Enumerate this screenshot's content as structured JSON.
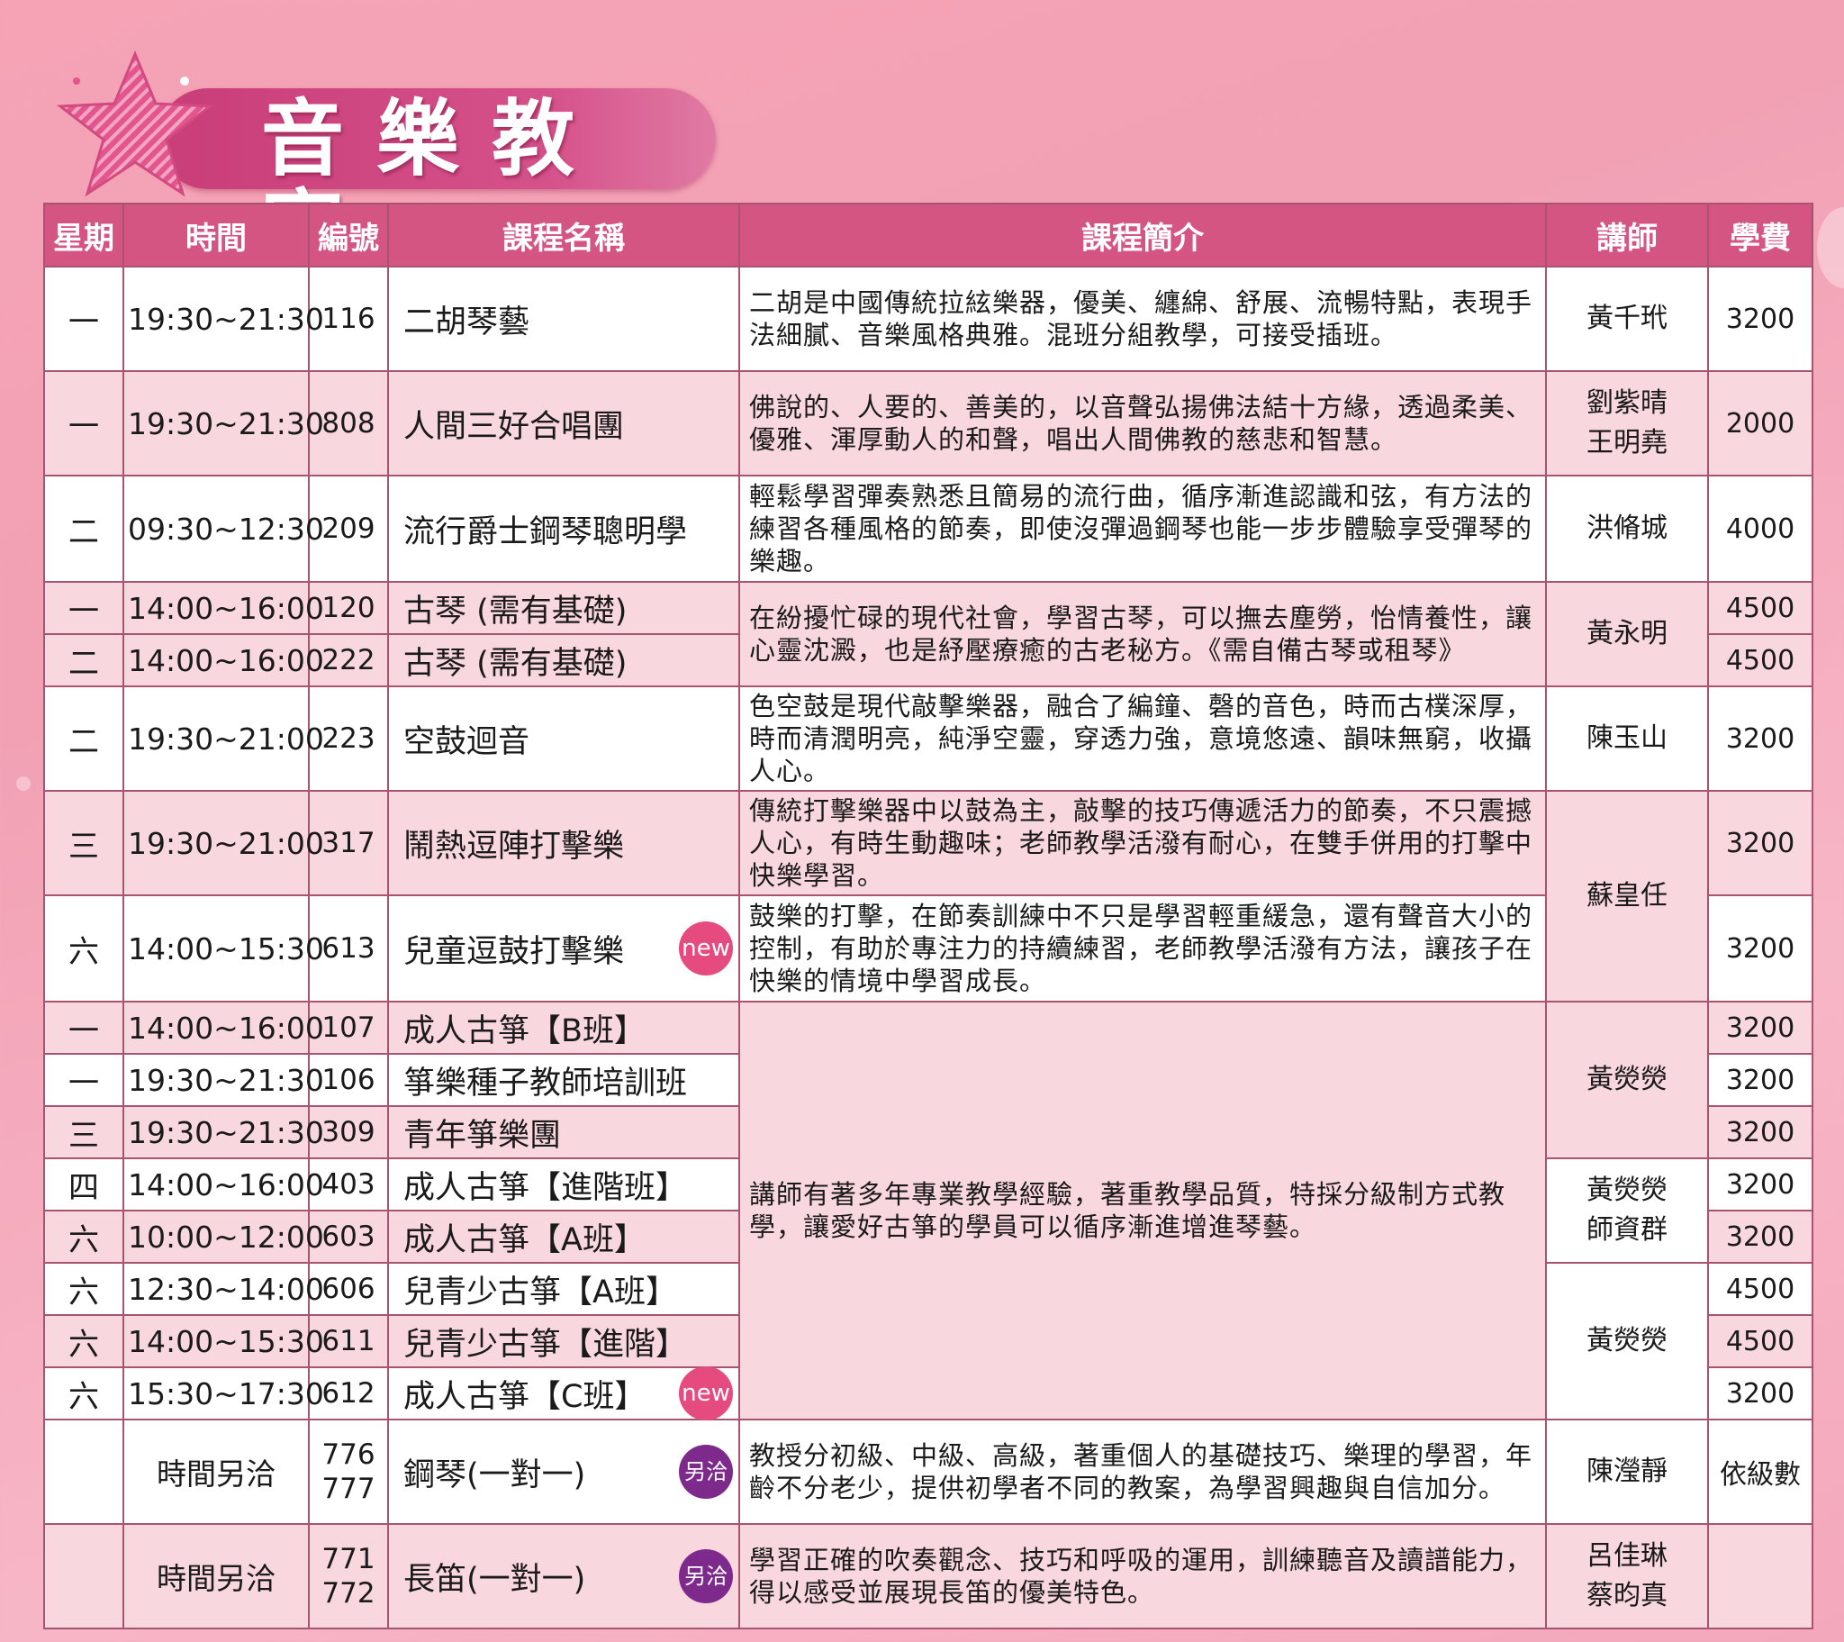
{
  "page": {
    "title": "音樂教室",
    "colors": {
      "header_bg": "#d45582",
      "row_pink": "#f9d7de",
      "row_white": "#ffffff",
      "badge_new": "#e54b7f",
      "badge_other": "#7e2a8c"
    }
  },
  "table": {
    "headers": [
      "星期",
      "時間",
      "編號",
      "課程名稱",
      "課程簡介",
      "講師",
      "學費"
    ],
    "rows": [
      {
        "day": "一",
        "time": "19:30~21:30",
        "code": "116",
        "name": "二胡琴藝",
        "desc": "二胡是中國傳統拉絃樂器，優美、纏綿、舒展、流暢特點，表現手法細膩、音樂風格典雅。混班分組教學，可接受插班。",
        "teacher": "黃千玳",
        "fee": "3200"
      },
      {
        "day": "一",
        "time": "19:30~21:30",
        "code": "808",
        "name": "人間三好合唱團",
        "desc": "佛說的、人要的、善美的，以音聲弘揚佛法結十方緣，透過柔美、優雅、渾厚動人的和聲，唱出人間佛教的慈悲和智慧。",
        "teacher": "劉紫晴",
        "teacher2": "王明堯",
        "fee": "2000"
      },
      {
        "day": "二",
        "time": "09:30~12:30",
        "code": "209",
        "name": "流行爵士鋼琴聰明學",
        "desc": "輕鬆學習彈奏熟悉且簡易的流行曲，循序漸進認識和弦，有方法的練習各種風格的節奏，即使沒彈過鋼琴也能一步步體驗享受彈琴的樂趣。",
        "teacher": "洪脩城",
        "fee": "4000"
      },
      {
        "day": "一",
        "time": "14:00~16:00",
        "code": "120",
        "name": "古琴 (需有基礎)",
        "desc": "在紛擾忙碌的現代社會，學習古琴，可以撫去塵勞，怡情養性，讓心靈沈澱，也是紓壓療癒的古老秘方。《需自備古琴或租琴》",
        "teacher": "黃永明",
        "fee": "4500"
      },
      {
        "day": "二",
        "time": "14:00~16:00",
        "code": "222",
        "name": "古琴 (需有基礎)",
        "fee": "4500"
      },
      {
        "day": "二",
        "time": "19:30~21:00",
        "code": "223",
        "name": "空鼓迴音",
        "desc": "色空鼓是現代敲擊樂器，融合了編鐘、磬的音色，時而古樸深厚，時而清潤明亮，純淨空靈，穿透力強，意境悠遠、韻味無窮，收攝人心。",
        "teacher": "陳玉山",
        "fee": "3200"
      },
      {
        "day": "三",
        "time": "19:30~21:00",
        "code": "317",
        "name": "鬧熱逗陣打擊樂",
        "desc": "傳統打擊樂器中以鼓為主，敲擊的技巧傳遞活力的節奏，不只震撼人心，有時生動趣味；老師教學活潑有耐心，在雙手併用的打擊中快樂學習。",
        "teacher": "蘇皇任",
        "fee": "3200"
      },
      {
        "day": "六",
        "time": "14:00~15:30",
        "code": "613",
        "name": "兒童逗鼓打擊樂",
        "badge": "new",
        "desc": "鼓樂的打擊，在節奏訓練中不只是學習輕重緩急，還有聲音大小的控制，有助於專注力的持續練習，老師教學活潑有方法，讓孩子在快樂的情境中學習成長。",
        "fee": "3200"
      },
      {
        "day": "一",
        "time": "14:00~16:00",
        "code": "107",
        "name": "成人古箏【B班】",
        "desc": "講師有著多年專業教學經驗，著重教學品質，特採分級制方式教學，讓愛好古箏的學員可以循序漸進增進琴藝。",
        "teacher": "黃熒熒",
        "fee": "3200"
      },
      {
        "day": "一",
        "time": "19:30~21:30",
        "code": "106",
        "name": "箏樂種子教師培訓班",
        "fee": "3200"
      },
      {
        "day": "三",
        "time": "19:30~21:30",
        "code": "309",
        "name": "青年箏樂團",
        "fee": "3200"
      },
      {
        "day": "四",
        "time": "14:00~16:00",
        "code": "403",
        "name": "成人古箏【進階班】",
        "teacher": "黃熒熒",
        "teacher2": "師資群",
        "fee": "3200"
      },
      {
        "day": "六",
        "time": "10:00~12:00",
        "code": "603",
        "name": "成人古箏【A班】",
        "fee": "3200"
      },
      {
        "day": "六",
        "time": "12:30~14:00",
        "code": "606",
        "name": "兒青少古箏【A班】",
        "teacher": "黃熒熒",
        "fee": "4500"
      },
      {
        "day": "六",
        "time": "14:00~15:30",
        "code": "611",
        "name": "兒青少古箏【進階】",
        "fee": "4500"
      },
      {
        "day": "六",
        "time": "15:30~17:30",
        "code": "612",
        "name": "成人古箏【C班】",
        "badge": "new",
        "fee": "3200"
      },
      {
        "day": "",
        "time": "時間另洽",
        "code": "776",
        "code2": "777",
        "name": "鋼琴(一對一)",
        "badge": "另洽",
        "desc": "教授分初級、中級、高級，著重個人的基礎技巧、樂理的學習，年齡不分老少，提供初學者不同的教案，為學習興趣與自信加分。",
        "teacher": "陳瀅靜",
        "fee": "依級數"
      },
      {
        "day": "",
        "time": "時間另洽",
        "code": "771",
        "code2": "772",
        "name": "長笛(一對一)",
        "badge": "另洽",
        "desc": "學習正確的吹奏觀念、技巧和呼吸的運用，訓練聽音及讀譜能力，得以感受並展現長笛的優美特色。",
        "teacher": "呂佳琳",
        "teacher2": "蔡昀真"
      }
    ]
  }
}
